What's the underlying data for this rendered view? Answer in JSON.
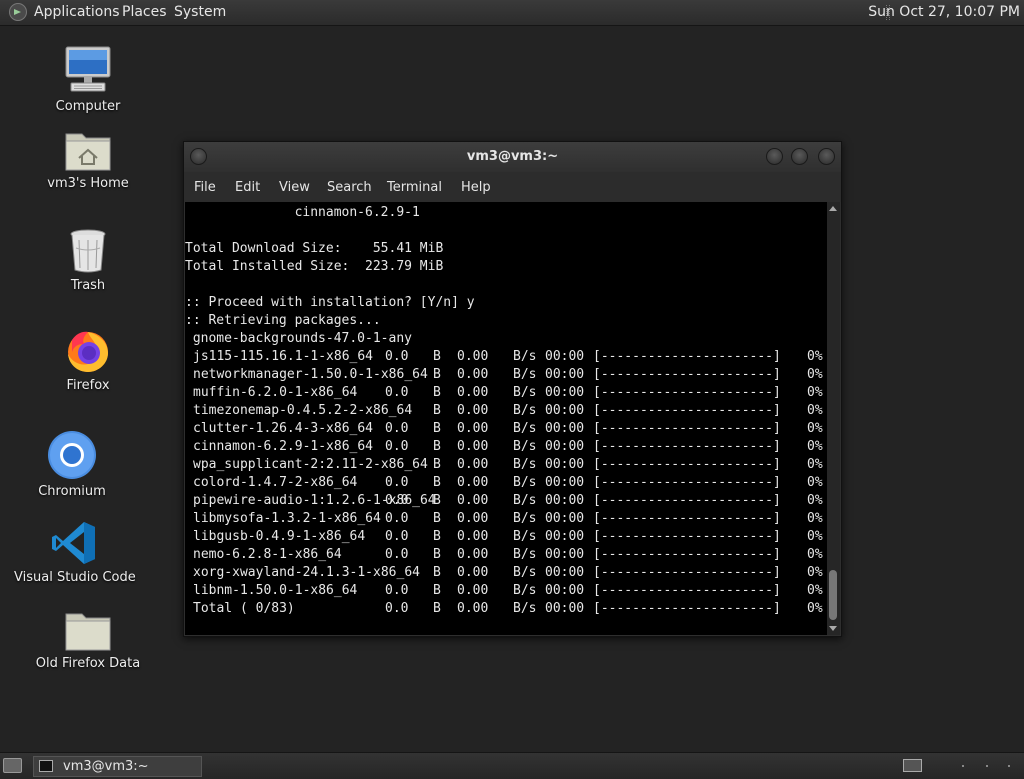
{
  "top_panel": {
    "menus": [
      "Applications",
      "Places",
      "System"
    ],
    "clock": "Sun Oct 27, 10:07 PM"
  },
  "desktop_icons": [
    {
      "label": "Computer",
      "icon": "computer-icon"
    },
    {
      "label": "vm3's Home",
      "icon": "home-folder-icon"
    },
    {
      "label": "Trash",
      "icon": "trash-icon"
    },
    {
      "label": "Firefox",
      "icon": "firefox-icon"
    },
    {
      "label": "Chromium",
      "icon": "chromium-icon"
    },
    {
      "label": "Visual Studio Code",
      "icon": "vscode-icon"
    },
    {
      "label": "Old Firefox Data",
      "icon": "folder-icon"
    }
  ],
  "terminal": {
    "title": "vm3@vm3:~",
    "menu": [
      "File",
      "Edit",
      "View",
      "Search",
      "Terminal",
      "Help"
    ],
    "header_lines": [
      "              cinnamon-6.2.9-1",
      "",
      "Total Download Size:    55.41 MiB",
      "Total Installed Size:  223.79 MiB",
      "",
      ":: Proceed with installation? [Y/n] y",
      ":: Retrieving packages...",
      " gnome-backgrounds-47.0-1-any"
    ],
    "packages": [
      {
        "name": "js115-115.16.1-1-x86_64",
        "size": "0.0",
        "unit": "B",
        "rate": "0.00",
        "rate_unit": "B/s",
        "time": "00:00",
        "bar": "[----------------------]",
        "pct": "0%"
      },
      {
        "name": "networkmanager-1.50.0-1-x86_64",
        "size": "",
        "unit": "B",
        "rate": "0.00",
        "rate_unit": "B/s",
        "time": "00:00",
        "bar": "[----------------------]",
        "pct": "0%"
      },
      {
        "name": "muffin-6.2.0-1-x86_64",
        "size": "0.0",
        "unit": "B",
        "rate": "0.00",
        "rate_unit": "B/s",
        "time": "00:00",
        "bar": "[----------------------]",
        "pct": "0%"
      },
      {
        "name": "timezonemap-0.4.5.2-2-x86_64",
        "size": "",
        "unit": "B",
        "rate": "0.00",
        "rate_unit": "B/s",
        "time": "00:00",
        "bar": "[----------------------]",
        "pct": "0%"
      },
      {
        "name": "clutter-1.26.4-3-x86_64",
        "size": "0.0",
        "unit": "B",
        "rate": "0.00",
        "rate_unit": "B/s",
        "time": "00:00",
        "bar": "[----------------------]",
        "pct": "0%"
      },
      {
        "name": "cinnamon-6.2.9-1-x86_64",
        "size": "0.0",
        "unit": "B",
        "rate": "0.00",
        "rate_unit": "B/s",
        "time": "00:00",
        "bar": "[----------------------]",
        "pct": "0%"
      },
      {
        "name": "wpa_supplicant-2:2.11-2-x86_64",
        "size": "",
        "unit": "B",
        "rate": "0.00",
        "rate_unit": "B/s",
        "time": "00:00",
        "bar": "[----------------------]",
        "pct": "0%"
      },
      {
        "name": "colord-1.4.7-2-x86_64",
        "size": "0.0",
        "unit": "B",
        "rate": "0.00",
        "rate_unit": "B/s",
        "time": "00:00",
        "bar": "[----------------------]",
        "pct": "0%"
      },
      {
        "name": "pipewire-audio-1:1.2.6-1-x86_64",
        "size": "0.0",
        "unit": "B",
        "rate": "0.00",
        "rate_unit": "B/s",
        "time": "00:00",
        "bar": "[----------------------]",
        "pct": "0%"
      },
      {
        "name": "libmysofa-1.3.2-1-x86_64",
        "size": "0.0",
        "unit": "B",
        "rate": "0.00",
        "rate_unit": "B/s",
        "time": "00:00",
        "bar": "[----------------------]",
        "pct": "0%"
      },
      {
        "name": "libgusb-0.4.9-1-x86_64",
        "size": "0.0",
        "unit": "B",
        "rate": "0.00",
        "rate_unit": "B/s",
        "time": "00:00",
        "bar": "[----------------------]",
        "pct": "0%"
      },
      {
        "name": "nemo-6.2.8-1-x86_64",
        "size": "0.0",
        "unit": "B",
        "rate": "0.00",
        "rate_unit": "B/s",
        "time": "00:00",
        "bar": "[----------------------]",
        "pct": "0%"
      },
      {
        "name": "xorg-xwayland-24.1.3-1-x86_64",
        "size": "",
        "unit": "B",
        "rate": "0.00",
        "rate_unit": "B/s",
        "time": "00:00",
        "bar": "[----------------------]",
        "pct": "0%"
      },
      {
        "name": "libnm-1.50.0-1-x86_64",
        "size": "0.0",
        "unit": "B",
        "rate": "0.00",
        "rate_unit": "B/s",
        "time": "00:00",
        "bar": "[----------------------]",
        "pct": "0%"
      },
      {
        "name": "Total ( 0/83)",
        "size": "0.0",
        "unit": "B",
        "rate": "0.00",
        "rate_unit": "B/s",
        "time": "00:00",
        "bar": "[----------------------]",
        "pct": "0%"
      }
    ]
  },
  "taskbar": {
    "window_button": "vm3@vm3:~"
  }
}
